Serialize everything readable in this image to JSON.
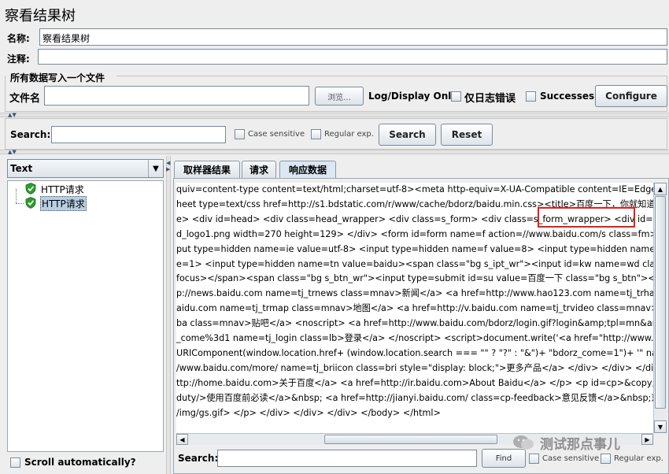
{
  "window": {
    "title": "察看结果树"
  },
  "form": {
    "name_label": "名称:",
    "name_value": "察看结果树",
    "comment_label": "注释:",
    "comment_value": ""
  },
  "file_section": {
    "title": "所有数据写入一个文件",
    "filename_label": "文件名",
    "filename_value": "",
    "browse_label": "浏览...",
    "log_display_label": "Log/Display Only:",
    "errors_label": "仅日志错误",
    "successes_label": "Successes",
    "configure_label": "Configure"
  },
  "search_bar": {
    "label": "Search:",
    "value": "",
    "case_sensitive_label": "Case sensitive",
    "regex_label": "Regular exp.",
    "search_button": "Search",
    "reset_button": "Reset"
  },
  "left_panel": {
    "renderer_selected": "Text",
    "tree_items": [
      {
        "label": "HTTP请求",
        "status": "success",
        "selected": false
      },
      {
        "label": "HTTP请求",
        "status": "success",
        "selected": true
      }
    ],
    "scroll_auto_label": "Scroll automatically?"
  },
  "tabs": [
    {
      "label": "取样器结果",
      "active": false
    },
    {
      "label": "请求",
      "active": false
    },
    {
      "label": "响应数据",
      "active": true
    }
  ],
  "response_lines": [
    "quiv=content-type content=text/html;charset=utf-8><meta http-equiv=X-UA-Compatible content=IE=Edge><meta",
    "heet type=text/css href=http://s1.bdstatic.com/r/www/cache/bdorz/baidu.min.css><title>百度一下，你就知道</titl",
    "e> <div id=head> <div class=head_wrapper> <div class=s_form> <div class=s_form_wrapper> <div id=lg> <i",
    "d_logo1.png width=270 height=129> </div> <form id=form name=f action=//www.baidu.com/s class=fm> <inpu",
    "put type=hidden name=ie value=utf-8> <input type=hidden name=f value=8> <input type=hidden name=rsv_bp",
    "e=1> <input type=hidden name=tn value=baidu><span class=\"bg s_ipt_wr\"><input id=kw name=wd class=s_",
    "focus></span><span class=\"bg s_btn_wr\"><input type=submit id=su value=百度一下 class=\"bg s_btn\"></spa",
    "p://news.baidu.com name=tj_trnews class=mnav>新闻</a> <a href=http://www.hao123.com name=tj_trhao123",
    "aidu.com name=tj_trmap class=mnav>地图</a> <a href=http://v.baidu.com name=tj_trvideo class=mnav>视频<",
    "ba class=mnav>贴吧</a> <noscript> <a href=http://www.baidu.com/bdorz/login.gif?login&amp;tpl=mn&amp;u=",
    "_come%3d1 name=tj_login class=lb>登录</a> </noscript> <script>document.write('<a href=\"http://www.baidu.c",
    "URIComponent(window.location.href+ (window.location.search === \"\" ? \"?\" : \"&\")+ \"bdorz_come=1\")+ '\" name=\"tj",
    "/www.baidu.com/more/ name=tj_briicon class=bri style=\"display: block;\">更多产品</a> </div> </div> </div",
    "ttp://home.baidu.com>关于百度</a> <a href=http://ir.baidu.com>About Baidu</a> </p> <p id=cp>&copy;2017&nb",
    "duty/>使用百度前必读</a>&nbsp; <a href=http://jianyi.baidu.com/ class=cp-feedback>意见反馈</a>&nbsp;京ICP",
    "/img/gs.gif> </p> </div> </div> </div> </body> </html>"
  ],
  "bottom_search": {
    "label": "Search:",
    "value": "",
    "find_button": "Find",
    "case_sensitive_label": "Case sensitive",
    "regex_label": "Regular exp."
  },
  "watermark": {
    "text": "测试那点事儿"
  },
  "colors": {
    "background": "#eeeeee",
    "selection": "#b8cfe5",
    "highlight_box": "#e0201b",
    "success_icon": "#2e9a2e"
  }
}
